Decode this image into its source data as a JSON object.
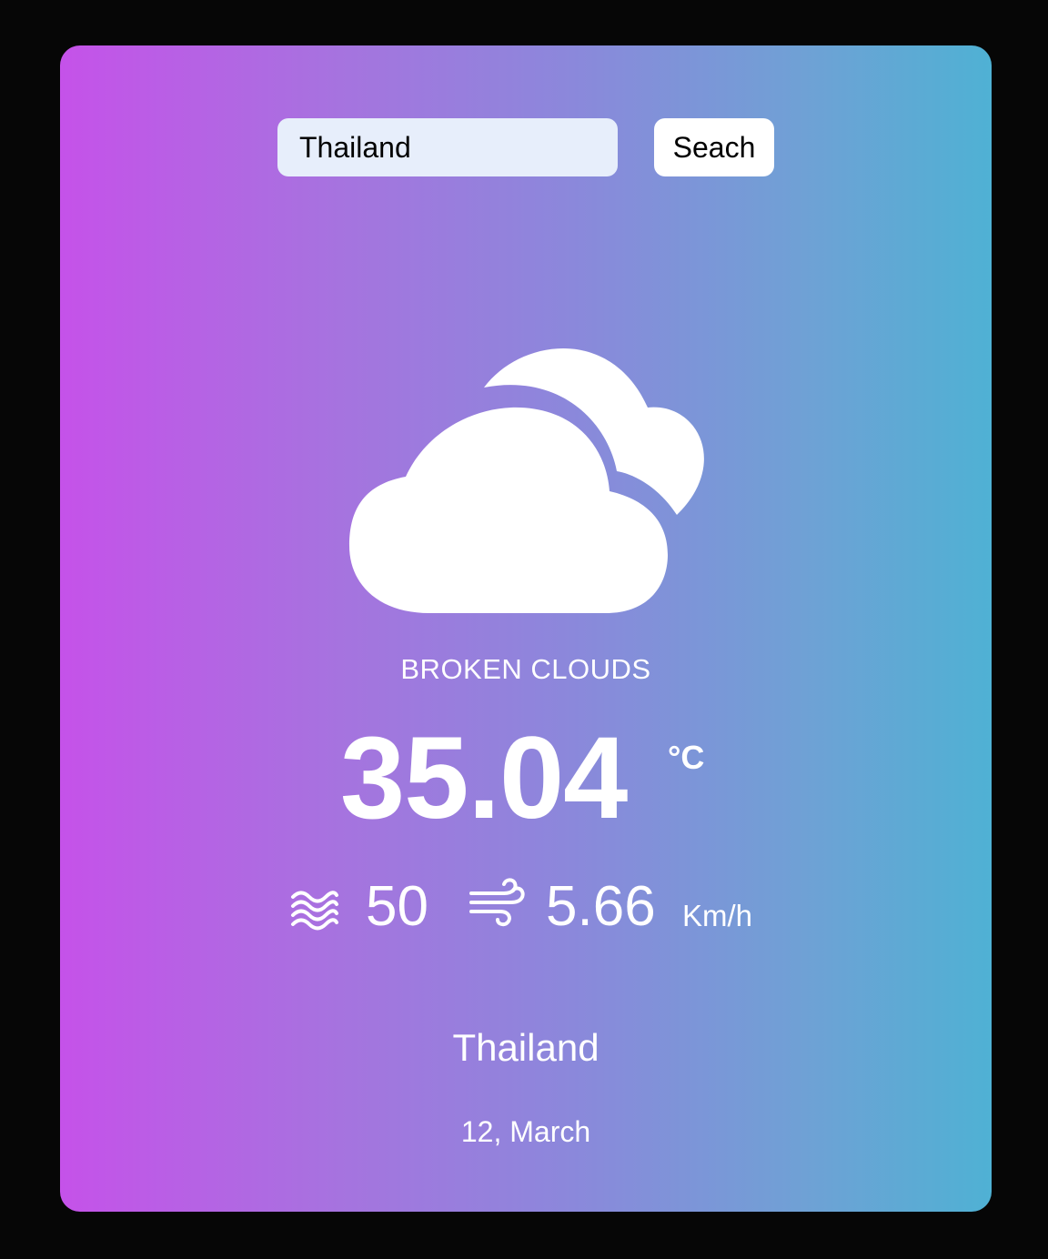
{
  "search": {
    "value": "Thailand",
    "button_label": "Seach"
  },
  "weather": {
    "icon": "broken-clouds-icon",
    "description": "BROKEN CLOUDS",
    "temperature": "35.04",
    "temperature_unit": "°C",
    "humidity_icon": "humidity-waves-icon",
    "humidity": "50",
    "wind_icon": "wind-icon",
    "wind_speed": "5.66",
    "wind_unit": "Km/h",
    "city": "Thailand",
    "date": "12, March"
  },
  "colors": {
    "background": "#060606",
    "gradient_start": "#c552e9",
    "gradient_end": "#4fb1d4",
    "input_background": "#e7eefb"
  }
}
